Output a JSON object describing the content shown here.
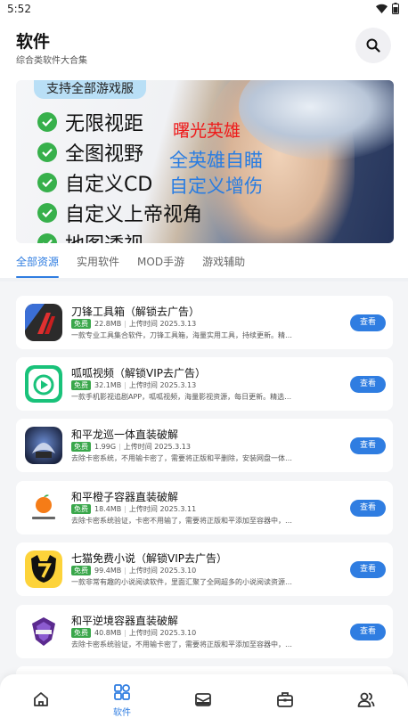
{
  "status_bar": {
    "time": "5:52"
  },
  "header": {
    "title": "软件",
    "subtitle": "综合类软件大合集"
  },
  "banner": {
    "tag": "支持全部游戏服",
    "lines": [
      "无限视距",
      "全图视野",
      "自定义CD",
      "自定义上帝视角",
      "地图透视"
    ],
    "overlay_red": "曙光英雄",
    "overlay_blue_1": "全英雄自瞄",
    "overlay_blue_2": "自定义增伤"
  },
  "tabs": [
    {
      "label": "全部资源",
      "active": true
    },
    {
      "label": "实用软件",
      "active": false
    },
    {
      "label": "MOD手游",
      "active": false
    },
    {
      "label": "游戏辅助",
      "active": false
    }
  ],
  "apps": [
    {
      "name": "刀锋工具箱（解锁去广告）",
      "badge": "免费",
      "size": "22.8MB",
      "upload": "上传时间 2025.3.13",
      "desc": "一款专业工具集合软件，刀锋工具箱，海量实用工具，持续更新。精选功能，覆盖...",
      "button": "查看",
      "icon": "blade-toolbox-icon"
    },
    {
      "name": "呱呱视频（解锁VIP去广告）",
      "badge": "免费",
      "size": "32.1MB",
      "upload": "上传时间 2025.3.13",
      "desc": "一款手机影视追剧APP，呱呱视频，海量影视资源，每日更新。精选内容，类型多...",
      "button": "查看",
      "icon": "guagua-video-icon"
    },
    {
      "name": "和平龙巡一体直装破解",
      "badge": "免费",
      "size": "1.99G",
      "upload": "上传时间 2025.3.13",
      "desc": "去除卡密系统，不用输卡密了，需要将正版和平删除，安装网盘一体直装包版，本...",
      "button": "查看",
      "icon": "dragon-game-icon"
    },
    {
      "name": "和平橙子容器直装破解",
      "badge": "免费",
      "size": "18.4MB",
      "upload": "上传时间 2025.3.11",
      "desc": "去除卡密系统验证，卡密不用输了，需要将正版和平添加至容器中，进入游戏后才...",
      "button": "查看",
      "icon": "orange-container-icon"
    },
    {
      "name": "七猫免费小说（解锁VIP去广告）",
      "badge": "免费",
      "size": "99.4MB",
      "upload": "上传时间 2025.3.10",
      "desc": "一款非常有趣的小说阅读软件，里面汇聚了全网超多的小说阅读资源，覆盖了各个...",
      "button": "查看",
      "icon": "qimao-novel-icon"
    },
    {
      "name": "和平逆境容器直装破解",
      "badge": "免费",
      "size": "40.8MB",
      "upload": "上传时间 2025.3.10",
      "desc": "去除卡密系统验证，不用输卡密了，需要将正版和平添加至容器中，本团队只对该...",
      "button": "查看",
      "icon": "nijing-container-icon"
    }
  ],
  "bottom_nav": [
    {
      "icon": "home-icon",
      "label": ""
    },
    {
      "icon": "grid-icon",
      "label": "软件",
      "active": true
    },
    {
      "icon": "mail-icon",
      "label": ""
    },
    {
      "icon": "toolbox-icon",
      "label": ""
    },
    {
      "icon": "users-icon",
      "label": ""
    }
  ],
  "colors": {
    "accent": "#2f7de1",
    "free_badge": "#3aa74b",
    "list_bg": "#f4f5f7"
  }
}
